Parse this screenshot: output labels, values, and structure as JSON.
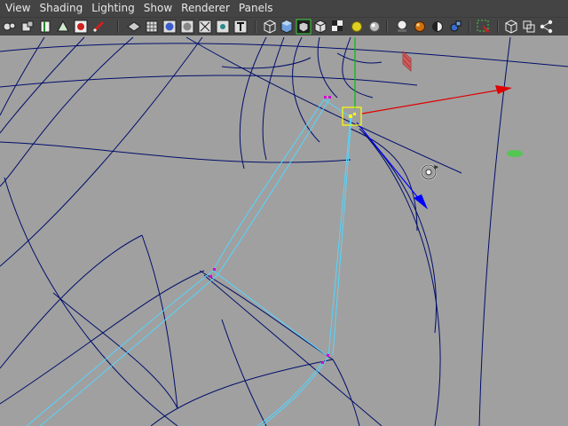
{
  "menubar": {
    "items": [
      {
        "id": "view",
        "label": "View"
      },
      {
        "id": "shading",
        "label": "Shading"
      },
      {
        "id": "lighting",
        "label": "Lighting"
      },
      {
        "id": "show",
        "label": "Show"
      },
      {
        "id": "renderer",
        "label": "Renderer"
      },
      {
        "id": "panels",
        "label": "Panels"
      }
    ]
  },
  "toolbar": {
    "icons": [
      "camera-select-icon",
      "camera-attributes-icon",
      "bookmarks-icon",
      "image-plane-icon",
      "film-gate-icon",
      "grease-pencil-icon",
      "resolution-gate-icon",
      "grid-icon",
      "smooth-shade-icon",
      "flat-shade-icon",
      "wireframe-on-shaded-icon",
      "x-ray-joints-icon",
      "text-icon",
      "wireframe-icon",
      "smooth-shade-all-icon",
      "isolate-select-icon",
      "textured-icon",
      "use-all-lights-icon",
      "shadows-icon",
      "high-quality-icon",
      "motion-blur-icon",
      "ambient-occlusion-icon",
      "anti-aliasing-icon",
      "depth-of-field-icon",
      "highlight-selection-icon",
      "single-view-icon",
      "four-view-icon",
      "hypergraph-icon"
    ]
  },
  "colors": {
    "ui_bg": "#444444",
    "viewport_bg": "#a0a0a0",
    "wire": "#000e6a",
    "selected_wire": "#54d6ff",
    "component": "#d400d4",
    "manip_x": "#e00000",
    "manip_y": "#00c000",
    "manip_z": "#0000ff",
    "pivot": "#ffff00"
  }
}
